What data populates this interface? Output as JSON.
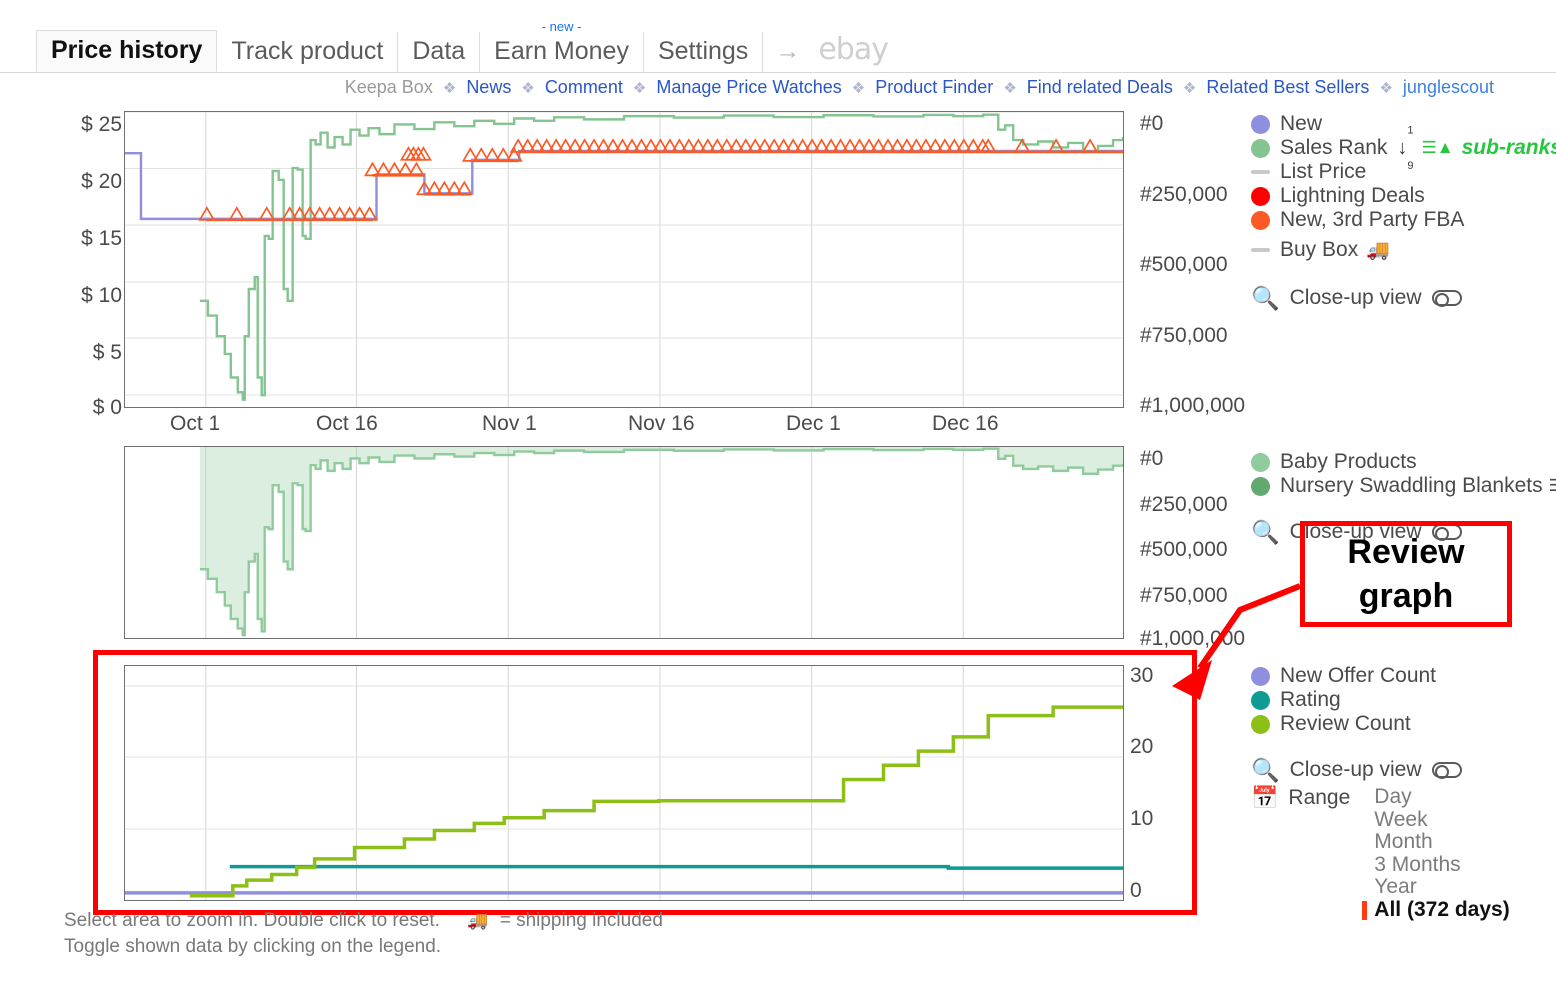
{
  "tabs": [
    {
      "label": "Price history",
      "active": true,
      "badge": ""
    },
    {
      "label": "Track product",
      "active": false,
      "badge": ""
    },
    {
      "label": "Data",
      "active": false,
      "badge": ""
    },
    {
      "label": "Earn Money",
      "active": false,
      "badge": "- new -"
    },
    {
      "label": "Settings",
      "active": false,
      "badge": ""
    }
  ],
  "tab_arrow": "→",
  "ebay_label": "ebay",
  "subnav": {
    "items": [
      {
        "label": "Keepa Box",
        "kind": "plain"
      },
      {
        "label": "News",
        "kind": "link"
      },
      {
        "label": "Comment",
        "kind": "link"
      },
      {
        "label": "Manage Price Watches",
        "kind": "link"
      },
      {
        "label": "Product Finder",
        "kind": "link"
      },
      {
        "label": "Find related Deals",
        "kind": "link"
      },
      {
        "label": "Related Best Sellers",
        "kind": "link"
      },
      {
        "label": "junglescout",
        "kind": "jungle"
      }
    ],
    "separator": "❖"
  },
  "colors": {
    "new": "#8f8fe0",
    "sales_rank": "#84c491",
    "list_price": "#c9c9c9",
    "lightning": "#ff0000",
    "fba": "#fb5a24",
    "buy_box": "#c9c9c9",
    "baby_products": "#90cb9d",
    "nursery": "#63a86f",
    "new_offer_count": "#8f8fe0",
    "rating": "#0f9b94",
    "review_count": "#8cc017",
    "annotation": "#ff0000",
    "subranks_green": "#27c63f"
  },
  "chart_data": [
    {
      "id": "price-history-chart",
      "type": "line",
      "title": "Price history",
      "xlabel": "",
      "ylabel": "",
      "grid": true,
      "x_ticks": [
        "Oct 1",
        "Oct 16",
        "Nov 1",
        "Nov 16",
        "Dec 1",
        "Dec 16"
      ],
      "x_tick_pos_pct": [
        8.1,
        23.2,
        38.4,
        53.6,
        68.8,
        84.0
      ],
      "y_left_ticks": [
        "$ 25",
        "$ 20",
        "$ 15",
        "$ 10",
        "$ 5",
        "$ 0"
      ],
      "y_left_values": [
        25,
        20,
        15,
        10,
        5,
        0
      ],
      "y_right_ticks": [
        "#0",
        "#250,000",
        "#500,000",
        "#750,000",
        "#1,000,000"
      ],
      "y_right_values": [
        0,
        250000,
        500000,
        750000,
        1000000
      ],
      "ylim_left": [
        0,
        26.5
      ],
      "ylim_right": [
        1000000,
        0
      ],
      "series": [
        {
          "name": "New",
          "color": "#8f8fe0",
          "axis": "left",
          "step": true,
          "points": [
            [
              0,
              22.8
            ],
            [
              1.6,
              22.8
            ],
            [
              1.6,
              16.9
            ],
            [
              25.2,
              16.9
            ],
            [
              25.2,
              20.9
            ],
            [
              30.0,
              20.9
            ],
            [
              30.0,
              19.2
            ],
            [
              34.8,
              19.2
            ],
            [
              34.8,
              22.2
            ],
            [
              39.5,
              22.2
            ],
            [
              39.5,
              23.0
            ],
            [
              100,
              23.0
            ]
          ]
        },
        {
          "name": "Sales Rank",
          "color": "#84c491",
          "axis": "right",
          "step": true,
          "points": [
            [
              7.5,
              640000
            ],
            [
              8.3,
              690000
            ],
            [
              9.2,
              760000
            ],
            [
              10.0,
              820000
            ],
            [
              10.6,
              900000
            ],
            [
              11.3,
              950000
            ],
            [
              11.8,
              975000
            ],
            [
              12.0,
              760000
            ],
            [
              12.4,
              600000
            ],
            [
              13.0,
              560000
            ],
            [
              13.3,
              900000
            ],
            [
              13.7,
              960000
            ],
            [
              14.0,
              420000
            ],
            [
              14.4,
              430000
            ],
            [
              14.8,
              200000
            ],
            [
              15.4,
              230000
            ],
            [
              15.9,
              600000
            ],
            [
              16.3,
              640000
            ],
            [
              16.8,
              190000
            ],
            [
              17.3,
              195000
            ],
            [
              17.8,
              420000
            ],
            [
              18.1,
              430000
            ],
            [
              18.6,
              95000
            ],
            [
              19.1,
              110000
            ],
            [
              19.6,
              70000
            ],
            [
              20.3,
              120000
            ],
            [
              21.0,
              85000
            ],
            [
              21.8,
              110000
            ],
            [
              22.6,
              60000
            ],
            [
              23.5,
              80000
            ],
            [
              24.4,
              55000
            ],
            [
              25.5,
              75000
            ],
            [
              27.0,
              42000
            ],
            [
              29.0,
              58000
            ],
            [
              31.0,
              35000
            ],
            [
              33.0,
              48000
            ],
            [
              35.0,
              30000
            ],
            [
              37.0,
              40000
            ],
            [
              39.0,
              22000
            ],
            [
              41.0,
              30000
            ],
            [
              43.0,
              18000
            ],
            [
              46.0,
              25000
            ],
            [
              50.0,
              14000
            ],
            [
              55.0,
              19000
            ],
            [
              60.0,
              12000
            ],
            [
              65.0,
              17000
            ],
            [
              70.0,
              11000
            ],
            [
              75.0,
              15000
            ],
            [
              80.0,
              10000
            ],
            [
              83.0,
              14000
            ],
            [
              86.0,
              9000
            ],
            [
              87.5,
              60000
            ],
            [
              88.2,
              45000
            ],
            [
              89.0,
              95000
            ],
            [
              90.0,
              110000
            ],
            [
              91.5,
              100000
            ],
            [
              93.0,
              120000
            ],
            [
              94.5,
              105000
            ],
            [
              96.0,
              135000
            ],
            [
              97.5,
              115000
            ],
            [
              99.0,
              95000
            ],
            [
              100,
              85000
            ]
          ]
        },
        {
          "name": "New, 3rd Party FBA",
          "color": "#fb5a24",
          "axis": "left",
          "step": true,
          "marker": "triangle",
          "description": "Dense cluster of upward triangle markers tracking the New price line"
        }
      ],
      "legend_position": "right"
    },
    {
      "id": "sales-rank-subranks-chart",
      "type": "area",
      "title": "",
      "grid": true,
      "x_ticks": [],
      "y_right_ticks": [
        "#0",
        "#250,000",
        "#500,000",
        "#750,000",
        "#1,000,000"
      ],
      "y_right_values": [
        0,
        250000,
        500000,
        750000,
        1000000
      ],
      "ylim_right": [
        1000000,
        0
      ],
      "series": [
        {
          "name": "Baby Products",
          "color": "#90cb9d",
          "fill": true,
          "points": [
            [
              7.5,
              640000
            ],
            [
              8.3,
              690000
            ],
            [
              9.2,
              760000
            ],
            [
              10.0,
              830000
            ],
            [
              10.6,
              900000
            ],
            [
              11.3,
              950000
            ],
            [
              11.8,
              985000
            ],
            [
              12.0,
              760000
            ],
            [
              12.4,
              600000
            ],
            [
              13.0,
              560000
            ],
            [
              13.3,
              900000
            ],
            [
              13.7,
              965000
            ],
            [
              14.0,
              420000
            ],
            [
              14.4,
              430000
            ],
            [
              14.8,
              200000
            ],
            [
              15.4,
              235000
            ],
            [
              15.9,
              600000
            ],
            [
              16.3,
              640000
            ],
            [
              16.8,
              190000
            ],
            [
              17.3,
              200000
            ],
            [
              17.8,
              430000
            ],
            [
              18.1,
              440000
            ],
            [
              18.6,
              95000
            ],
            [
              19.1,
              115000
            ],
            [
              19.6,
              70000
            ],
            [
              20.3,
              125000
            ],
            [
              21.0,
              85000
            ],
            [
              21.8,
              115000
            ],
            [
              22.6,
              60000
            ],
            [
              23.5,
              85000
            ],
            [
              24.4,
              55000
            ],
            [
              25.5,
              78000
            ],
            [
              27.0,
              45000
            ],
            [
              29.0,
              60000
            ],
            [
              31.0,
              38000
            ],
            [
              33.0,
              50000
            ],
            [
              35.0,
              32000
            ],
            [
              37.0,
              42000
            ],
            [
              39.0,
              24000
            ],
            [
              41.0,
              32000
            ],
            [
              43.0,
              19000
            ],
            [
              46.0,
              26000
            ],
            [
              50.0,
              15000
            ],
            [
              55.0,
              20000
            ],
            [
              60.0,
              13000
            ],
            [
              65.0,
              18000
            ],
            [
              70.0,
              11000
            ],
            [
              75.0,
              16000
            ],
            [
              80.0,
              10000
            ],
            [
              83.0,
              15000
            ],
            [
              86.0,
              9000
            ],
            [
              87.5,
              62000
            ],
            [
              88.2,
              46000
            ],
            [
              89.0,
              98000
            ],
            [
              90.0,
              115000
            ],
            [
              91.5,
              102000
            ],
            [
              93.0,
              125000
            ],
            [
              94.5,
              108000
            ],
            [
              96.0,
              140000
            ],
            [
              97.5,
              118000
            ],
            [
              99.0,
              98000
            ],
            [
              100,
              88000
            ]
          ]
        },
        {
          "name": "Nursery Swaddling Blankets",
          "color": "#63a86f",
          "fill": false,
          "points": []
        }
      ],
      "legend_position": "right"
    },
    {
      "id": "review-graph-chart",
      "type": "line",
      "title": "",
      "grid": true,
      "x_ticks": [],
      "y_right_ticks": [
        "30",
        "20",
        "10",
        "0"
      ],
      "y_right_values": [
        30,
        20,
        10,
        0
      ],
      "ylim_right": [
        0,
        33
      ],
      "series": [
        {
          "name": "New Offer Count",
          "color": "#8f8fe0",
          "step": true,
          "points": [
            [
              0,
              1
            ],
            [
              100,
              1
            ]
          ]
        },
        {
          "name": "Rating",
          "color": "#0f9b94",
          "step": true,
          "points": [
            [
              10.5,
              4.7
            ],
            [
              82.5,
              4.7
            ],
            [
              82.5,
              4.5
            ],
            [
              100,
              4.5
            ]
          ]
        },
        {
          "name": "Review Count",
          "color": "#8cc017",
          "step": true,
          "points": [
            [
              6.5,
              0.6
            ],
            [
              10.8,
              0.6
            ],
            [
              10.8,
              2.0
            ],
            [
              12.2,
              2.0
            ],
            [
              12.2,
              2.8
            ],
            [
              14.7,
              2.8
            ],
            [
              14.7,
              3.6
            ],
            [
              17.2,
              3.6
            ],
            [
              17.2,
              4.6
            ],
            [
              19.0,
              4.6
            ],
            [
              19.0,
              5.8
            ],
            [
              23.0,
              5.8
            ],
            [
              23.0,
              7.4
            ],
            [
              28.0,
              7.4
            ],
            [
              28.0,
              8.6
            ],
            [
              31.0,
              8.6
            ],
            [
              31.0,
              9.8
            ],
            [
              35.0,
              9.8
            ],
            [
              35.0,
              10.8
            ],
            [
              38.0,
              10.8
            ],
            [
              38.0,
              11.6
            ],
            [
              42.0,
              11.6
            ],
            [
              42.0,
              12.6
            ],
            [
              47.0,
              12.6
            ],
            [
              47.0,
              13.9
            ],
            [
              53.5,
              13.9
            ],
            [
              53.5,
              14.0
            ],
            [
              72.0,
              14.0
            ],
            [
              72.0,
              17.0
            ],
            [
              76.0,
              17.0
            ],
            [
              76.0,
              19.0
            ],
            [
              79.5,
              19.0
            ],
            [
              79.5,
              21.0
            ],
            [
              83.0,
              21.0
            ],
            [
              83.0,
              23.0
            ],
            [
              86.5,
              23.0
            ],
            [
              86.5,
              26.0
            ],
            [
              93.0,
              26.0
            ],
            [
              93.0,
              27.2
            ],
            [
              100,
              27.2
            ]
          ]
        }
      ],
      "legend_position": "right"
    }
  ],
  "legend1": {
    "items": [
      {
        "label": "New",
        "marker": "dot",
        "color": "#8f8fe0"
      },
      {
        "label": "Sales Rank",
        "marker": "dot",
        "color": "#84c491",
        "rank_arrow": "↓",
        "rank_sup": "1",
        "rank_sub": "9",
        "subranks": "sub-ranks"
      },
      {
        "label": "List Price",
        "marker": "dash",
        "color": "#c9c9c9"
      },
      {
        "label": "Lightning Deals",
        "marker": "dot",
        "color": "#ff0000"
      },
      {
        "label": "New, 3rd Party FBA",
        "marker": "dot",
        "color": "#fb5a24"
      },
      {
        "label": "Buy Box",
        "marker": "dash",
        "color": "#c9c9c9",
        "truck": "🚚"
      }
    ],
    "closeup_label": "Close-up view"
  },
  "legend2": {
    "items": [
      {
        "label": "Baby Products",
        "marker": "dot",
        "color": "#90cb9d"
      },
      {
        "label": "Nursery Swaddling Blankets",
        "marker": "dot",
        "color": "#63a86f",
        "tree": true
      }
    ],
    "closeup_label": "Close-up view"
  },
  "legend3": {
    "items": [
      {
        "label": "New Offer Count",
        "marker": "dot",
        "color": "#8f8fe0"
      },
      {
        "label": "Rating",
        "marker": "dot",
        "color": "#0f9b94"
      },
      {
        "label": "Review Count",
        "marker": "dot",
        "color": "#8cc017"
      }
    ],
    "closeup_label": "Close-up view",
    "range_label": "Range",
    "range_options": [
      {
        "label": "Day",
        "selected": false
      },
      {
        "label": "Week",
        "selected": false
      },
      {
        "label": "Month",
        "selected": false
      },
      {
        "label": "3 Months",
        "selected": false
      },
      {
        "label": "Year",
        "selected": false
      },
      {
        "label": "All (372 days)",
        "selected": true
      }
    ]
  },
  "annotation": {
    "text_line1": "Review",
    "text_line2": "graph"
  },
  "footer": {
    "line1a": "Select area to zoom in. Double click to reset.",
    "truck": "🚚",
    "line1b": "= shipping included",
    "line2": "Toggle shown data by clicking on the legend."
  }
}
